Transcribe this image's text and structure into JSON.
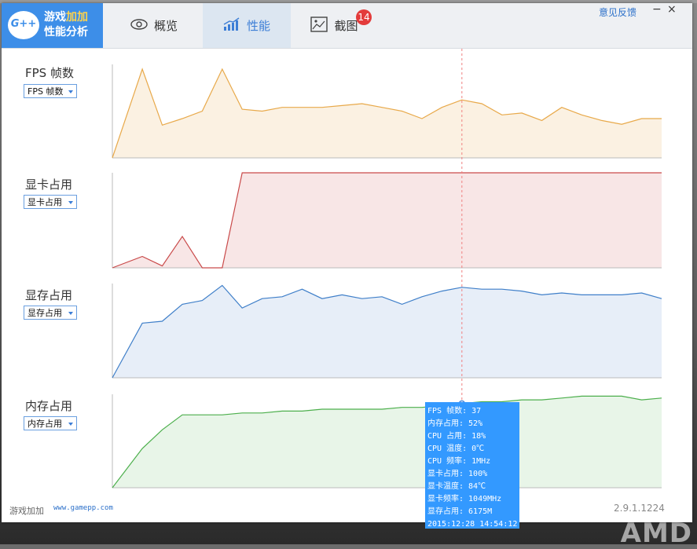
{
  "app": {
    "logo_icon_text": "G++",
    "logo_line1_a": "游戏",
    "logo_line1_b": "加加",
    "logo_line2": "性能分析"
  },
  "tabs": [
    {
      "label": "概览",
      "icon": "eye-icon"
    },
    {
      "label": "性能",
      "icon": "performance-chart-icon",
      "active": true
    },
    {
      "label": "截图",
      "icon": "image-icon",
      "badge": "14"
    }
  ],
  "window": {
    "feedback_label": "意见反馈",
    "minimize_label": "−",
    "close_label": "×"
  },
  "rows": [
    {
      "label": "FPS 帧数",
      "select": "FPS 帧数"
    },
    {
      "label": "显卡占用",
      "select": "显卡占用"
    },
    {
      "label": "显存占用",
      "select": "显存占用"
    },
    {
      "label": "内存占用",
      "select": "内存占用"
    }
  ],
  "colors": {
    "accent": "#3d8ee8",
    "fps_line": "#e8a94a",
    "fps_fill": "#fbf1e2",
    "gpu_line": "#c94a4a",
    "gpu_fill": "#f8e6e6",
    "vram_line": "#3f7fc9",
    "vram_fill": "#e7eef8",
    "ram_line": "#4caf4c",
    "ram_fill": "#e8f5e8",
    "tooltip_bg": "#3399ff",
    "badge": "#e33b3b"
  },
  "chart_data": [
    {
      "type": "area",
      "title": "FPS 帧数",
      "x": [
        0,
        1.5,
        2.5,
        3.5,
        4.5,
        5.5,
        6.5,
        7.5,
        8.5,
        9.5,
        10.5,
        11.5,
        12.5,
        13.5,
        14.5,
        15.5,
        16.5,
        17.5,
        18.5,
        19.5,
        20.5,
        21.5,
        22.5,
        23.5,
        24.5,
        25.5,
        26.5,
        27.5
      ],
      "values": [
        0,
        0.95,
        0.35,
        0.42,
        0.5,
        0.95,
        0.52,
        0.5,
        0.54,
        0.54,
        0.54,
        0.56,
        0.58,
        0.54,
        0.5,
        0.42,
        0.54,
        0.62,
        0.58,
        0.46,
        0.48,
        0.4,
        0.54,
        0.46,
        0.4,
        0.36,
        0.42,
        0.42
      ],
      "ylim": [
        0,
        1
      ]
    },
    {
      "type": "area",
      "title": "显卡占用",
      "x": [
        0,
        1.5,
        2.5,
        3.5,
        4.5,
        5.5,
        6.5,
        27.5
      ],
      "values": [
        0,
        0.12,
        0.02,
        0.33,
        0,
        0,
        1,
        1
      ],
      "ylim": [
        0,
        1
      ]
    },
    {
      "type": "area",
      "title": "显存占用",
      "x": [
        0,
        1.5,
        2.5,
        3.5,
        4.5,
        5.5,
        6.5,
        7.5,
        8.5,
        9.5,
        10.5,
        11.5,
        12.5,
        13.5,
        14.5,
        15.5,
        16.5,
        17.5,
        18.5,
        19.5,
        20.5,
        21.5,
        22.5,
        23.5,
        24.5,
        25.5,
        26.5,
        27.5
      ],
      "values": [
        0,
        0.58,
        0.6,
        0.78,
        0.82,
        0.98,
        0.74,
        0.84,
        0.86,
        0.94,
        0.84,
        0.88,
        0.84,
        0.86,
        0.78,
        0.86,
        0.92,
        0.96,
        0.94,
        0.94,
        0.92,
        0.88,
        0.9,
        0.88,
        0.88,
        0.88,
        0.9,
        0.84
      ],
      "ylim": [
        0,
        1
      ]
    },
    {
      "type": "area",
      "title": "内存占用",
      "x": [
        0,
        1.5,
        2.5,
        3.5,
        4.5,
        5.5,
        6.5,
        7.5,
        8.5,
        9.5,
        10.5,
        11.5,
        12.5,
        13.5,
        14.5,
        15.5,
        16.5,
        17.5,
        18.5,
        19.5,
        20.5,
        21.5,
        22.5,
        23.5,
        24.5,
        25.5,
        26.5,
        27.5
      ],
      "values": [
        0,
        0.42,
        0.62,
        0.78,
        0.78,
        0.78,
        0.8,
        0.8,
        0.82,
        0.82,
        0.84,
        0.84,
        0.84,
        0.84,
        0.86,
        0.86,
        0.88,
        0.9,
        0.92,
        0.92,
        0.94,
        0.94,
        0.96,
        0.98,
        0.98,
        0.98,
        0.94,
        0.96
      ],
      "ylim": [
        0,
        1
      ]
    }
  ],
  "cursor": {
    "x": 17.5
  },
  "tooltip": [
    "FPS 帧数: 37",
    "内存占用: 52%",
    "CPU 占用: 18%",
    "CPU 温度: 0℃",
    "CPU 频率: 1MHz",
    "显卡占用: 100%",
    "显卡温度: 84℃",
    "显卡频率: 1049MHz",
    "显存占用: 6175M",
    "2015:12:28 14:54:12"
  ],
  "footer": {
    "brand": "游戏加加",
    "url": "www.gamepp.com",
    "version": "2.9.1.1224"
  },
  "background": {
    "watermark": "AMD"
  }
}
